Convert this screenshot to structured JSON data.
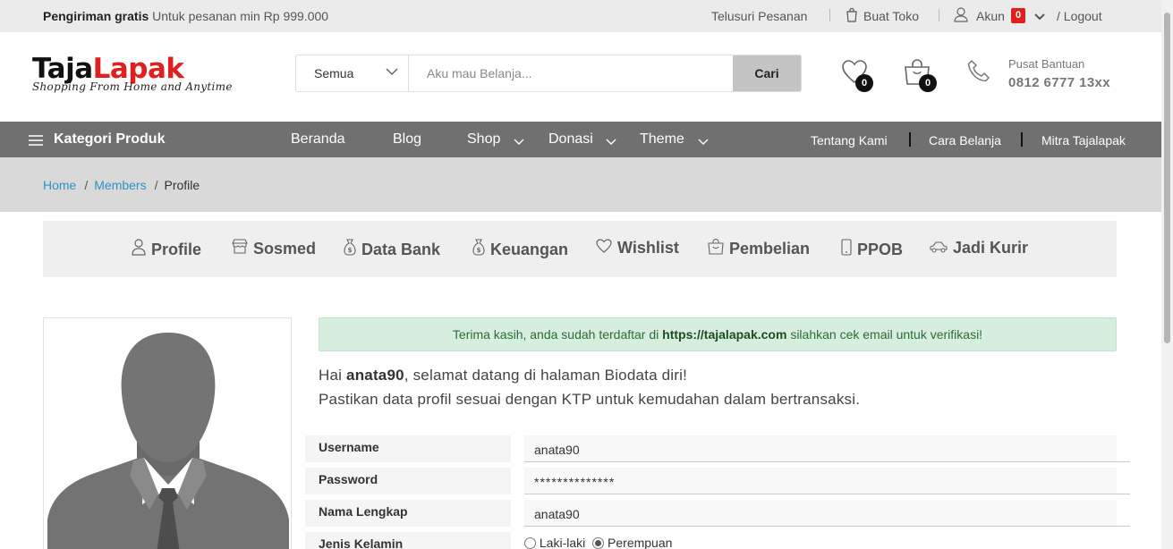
{
  "topbar": {
    "promo_bold": "Pengiriman gratis",
    "promo_text": "Untuk pesanan min Rp 999.000",
    "track_orders": "Telusuri Pesanan",
    "open_store": "Buat Toko",
    "account": "Akun",
    "account_badge": "0",
    "logout": "/ Logout"
  },
  "logo": {
    "part1": "Taja",
    "part2": "Lapak",
    "tagline": "Shopping From Home and Anytime"
  },
  "search": {
    "category": "Semua",
    "placeholder": "Aku mau Belanja...",
    "button": "Cari"
  },
  "header_icons": {
    "wishlist_count": "0",
    "cart_count": "0"
  },
  "help": {
    "label": "Pusat Bantuan",
    "phone": "0812 6777 13xx"
  },
  "nav": {
    "categories": "Kategori Produk",
    "home": "Beranda",
    "blog": "Blog",
    "shop": "Shop",
    "donation": "Donasi",
    "theme": "Theme",
    "about": "Tentang Kami",
    "how_to_shop": "Cara Belanja",
    "partner": "Mitra Tajalapak"
  },
  "breadcrumb": {
    "home": "Home",
    "members": "Members",
    "current": "Profile"
  },
  "tabs": {
    "profile": "Profile",
    "sosmed": "Sosmed",
    "bank": "Data Bank",
    "finance": "Keuangan",
    "wishlist": "Wishlist",
    "purchases": "Pembelian",
    "ppob": "PPOB",
    "courier": "Jadi Kurir"
  },
  "alert": {
    "before": "Terima kasih, anda sudah terdaftar di",
    "site": "https://tajalapak.com",
    "after": "silahkan cek email untuk verifikasi!"
  },
  "greeting": {
    "hello": "Hai",
    "username": "anata90",
    "line1_rest": ", selamat datang di halaman Biodata diri!",
    "line2": "Pastikan data profil sesuai dengan KTP untuk kemudahan dalam bertransaksi."
  },
  "form": {
    "username_label": "Username",
    "username_value": "anata90",
    "password_label": "Password",
    "password_value": "**************",
    "fullname_label": "Nama Lengkap",
    "fullname_value": "anata90",
    "gender_label": "Jenis Kelamin",
    "gender_male": "Laki-laki",
    "gender_female": "Perempuan",
    "gender_selected": "Perempuan"
  },
  "colors": {
    "accent_red": "#e0201f",
    "nav_bg": "#707070",
    "link_blue": "#2f91c9",
    "alert_bg": "#d6eedd"
  }
}
